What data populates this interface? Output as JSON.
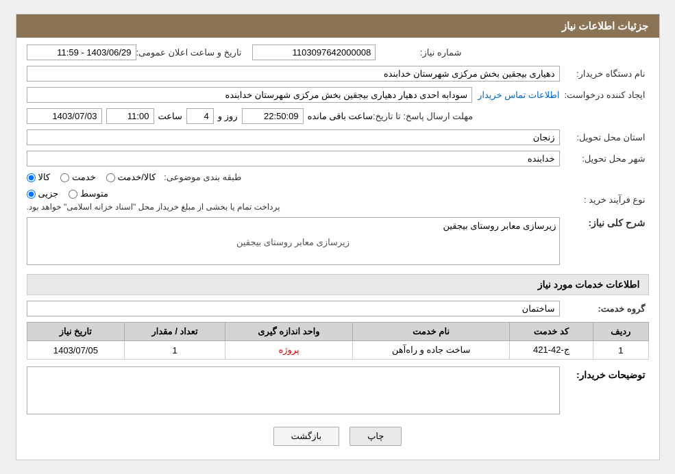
{
  "page": {
    "title": "جزئیات اطلاعات نیاز"
  },
  "header": {
    "announcement_id_label": "شماره نیاز:",
    "announcement_id_value": "1103097642000008",
    "date_label": "تاریخ و ساعت اعلان عمومی:",
    "date_value": "1403/06/29 - 11:59",
    "buyer_name_label": "نام دستگاه خریدار:",
    "buyer_name_value": "دهیاری بیجقین بخش مرکزی شهرستان خدابنده",
    "creator_label": "ایجاد کننده درخواست:",
    "creator_value": "سودابه احدی دهیار دهیاری بیجقین بخش مرکزی شهرستان خدابنده",
    "contact_link": "اطلاعات تماس خریدار",
    "deadline_label": "مهلت ارسال پاسخ: تا تاریخ:",
    "deadline_date": "1403/07/03",
    "deadline_time_label": "ساعت",
    "deadline_time": "11:00",
    "deadline_days_label": "روز و",
    "deadline_days": "4",
    "deadline_remaining_label": "ساعت باقی مانده",
    "deadline_remaining": "22:50:09",
    "province_label": "استان محل تحویل:",
    "province_value": "زنجان",
    "city_label": "شهر محل تحویل:",
    "city_value": "خدابنده",
    "category_label": "طبقه بندی موضوعی:",
    "category_options": [
      {
        "id": "kala",
        "label": "کالا",
        "checked": true
      },
      {
        "id": "khedmat",
        "label": "خدمت",
        "checked": false
      },
      {
        "id": "kala_khedmat",
        "label": "کالا/خدمت",
        "checked": false
      }
    ],
    "purchase_type_label": "نوع فرآیند خرید :",
    "purchase_options": [
      {
        "id": "jozyi",
        "label": "جزیی",
        "checked": true
      },
      {
        "id": "moutaset",
        "label": "متوسط",
        "checked": false
      }
    ],
    "purchase_note": "پرداخت تمام یا بخشی از مبلغ خریداز محل \"اسناد خزانه اسلامی\" خواهد بود."
  },
  "description": {
    "section_title": "شرح کلی نیاز:",
    "value": "زیرسازی معابر روستای بیجقین"
  },
  "services_section": {
    "title": "اطلاعات خدمات مورد نیاز",
    "service_group_label": "گروه خدمت:",
    "service_group_value": "ساختمان"
  },
  "table": {
    "columns": [
      "ردیف",
      "کد خدمت",
      "نام خدمت",
      "واحد اندازه گیری",
      "تعداد / مقدار",
      "تاریخ نیاز"
    ],
    "rows": [
      {
        "row_num": "1",
        "service_code": "ج-42-421",
        "service_name": "ساخت جاده و راه‌آهن",
        "unit": "پروژه",
        "quantity": "1",
        "date": "1403/07/05"
      }
    ]
  },
  "buyer_notes": {
    "label": "توضیحات خریدار:",
    "value": ""
  },
  "buttons": {
    "print": "چاپ",
    "back": "بازگشت"
  }
}
